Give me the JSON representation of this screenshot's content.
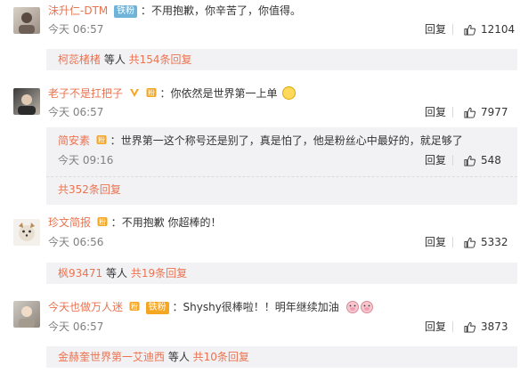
{
  "comments": [
    {
      "username": "沬升仁-DTM",
      "badge": "铁粉",
      "text": "不用抱歉，你辛苦了，你值得。",
      "time": "今天 06:57",
      "reply_label": "回复",
      "likes": "12104",
      "replies_summary": {
        "names": "柯蕊楮楮",
        "middle": " 等人 ",
        "count": "共154条回复"
      }
    },
    {
      "username": "老子不是扛把子",
      "text": "你依然是世界第一上单",
      "time": "今天 06:57",
      "reply_label": "回复",
      "likes": "7977",
      "sub_reply": {
        "username": "简安素",
        "text": "世界第一这个称号还是别了，真是怕了，他是粉丝心中最好的，就足够了",
        "time": "今天 09:16",
        "reply_label": "回复",
        "likes": "548"
      },
      "replies_summary": {
        "count": "共352条回复"
      }
    },
    {
      "username": "珍文简报",
      "text": "不用抱歉 你超棒的！",
      "time": "今天 06:56",
      "reply_label": "回复",
      "likes": "5332",
      "replies_summary": {
        "names": "枫93471",
        "middle": " 等人 ",
        "count": "共19条回复"
      }
    },
    {
      "username": "今天也做万人迷",
      "badge": "铁粉",
      "text": "Shyshy很棒啦！！明年继续加油",
      "time": "今天 06:57",
      "reply_label": "回复",
      "likes": "3873",
      "replies_summary": {
        "names": "金赫奎世界第一艾迪西",
        "middle": " 等人 ",
        "count": "共10条回复"
      }
    }
  ],
  "colors": {
    "accent": "#eb7350",
    "muted": "#808080",
    "subbox": "#f2f2f5",
    "badge": "#f5a623"
  }
}
